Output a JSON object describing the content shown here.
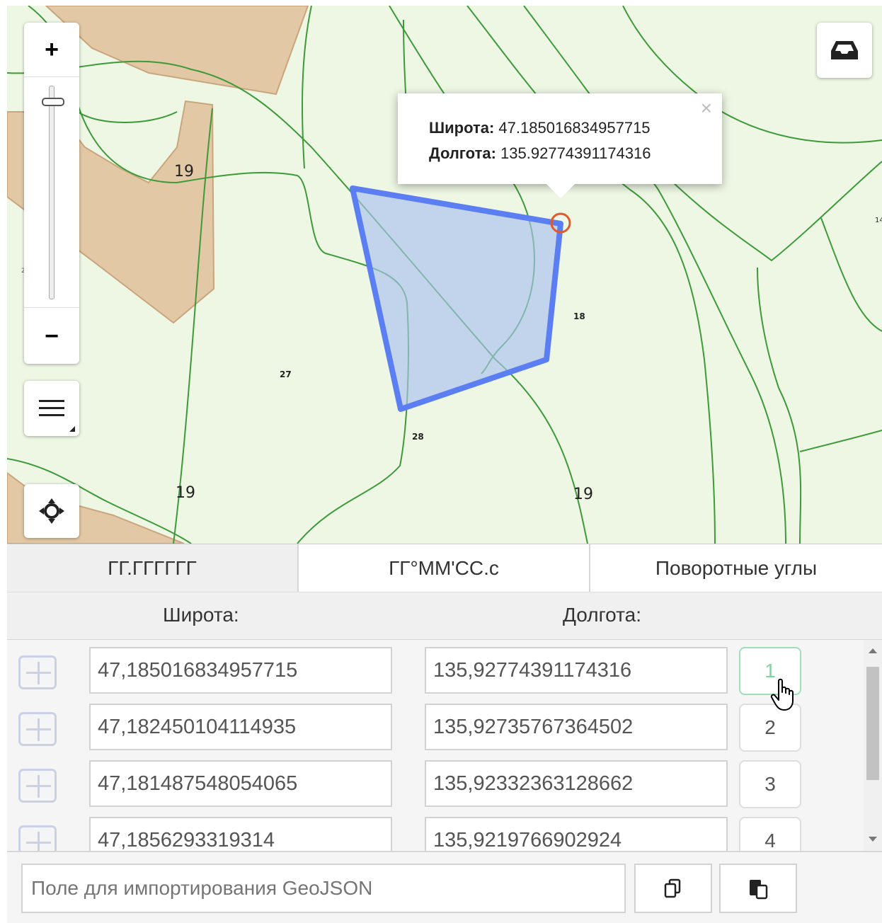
{
  "map": {
    "labels": [
      {
        "id": "19a",
        "text": "19"
      },
      {
        "id": "19b",
        "text": "19"
      },
      {
        "id": "19c",
        "text": "19"
      },
      {
        "id": "18",
        "text": "18"
      },
      {
        "id": "27",
        "text": "27"
      },
      {
        "id": "28",
        "text": "28"
      },
      {
        "id": "26",
        "text": "26"
      },
      {
        "id": "14",
        "text": "14"
      }
    ],
    "popup": {
      "lat_label": "Широта:",
      "lat_value": "47.185016834957715",
      "lon_label": "Долгота:",
      "lon_value": "135.92774391174316",
      "close": "×"
    },
    "controls": {
      "zoom_in": "+",
      "zoom_out": "−",
      "zoom_level": 0.93
    }
  },
  "tabs": [
    {
      "label": "ГГ.ГГГГГГ"
    },
    {
      "label": "ГГ°ММ'СС.с"
    },
    {
      "label": "Поворотные углы"
    }
  ],
  "columns": {
    "lat": "Широта:",
    "lon": "Долгота:"
  },
  "rows": [
    {
      "lat": "47,185016834957715",
      "lon": "135,92774391174316",
      "n": "1"
    },
    {
      "lat": "47,182450104114935",
      "lon": "135,92735767364502",
      "n": "2"
    },
    {
      "lat": "47,181487548054065",
      "lon": "135,92332363128662",
      "n": "3"
    },
    {
      "lat": "47,1856293319314",
      "lon": "135,9219766902924",
      "n": "4"
    }
  ],
  "footer": {
    "geojson_placeholder": "Поле для импортирования GeoJSON"
  },
  "colors": {
    "map_bg": "#eef7e4",
    "contour": "#3d9a3a",
    "polygon_stroke": "#5b7ff2",
    "polygon_fill": "#a9c2ee",
    "parcel": "#e2c8a4",
    "marker": "#e05a2b"
  }
}
